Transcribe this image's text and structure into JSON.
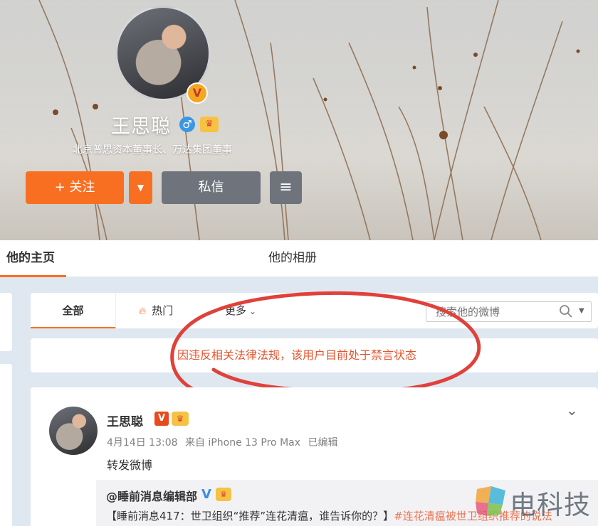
{
  "profile": {
    "name": "王思聪",
    "description": "北京普思资本董事长、万达集团董事",
    "verified_badge": "V",
    "gender_icon": "male-icon",
    "gender_symbol": "♂",
    "crown_symbol": "♛"
  },
  "actions": {
    "follow_label": "+ 关注",
    "follow_more": "▼",
    "message_label": "私信",
    "menu_symbol": "≡"
  },
  "tabs": [
    {
      "label": "他的主页",
      "active": true
    },
    {
      "label": "他的相册",
      "active": false
    }
  ],
  "filter": {
    "all_label": "全部",
    "hot_label": "热门",
    "hot_icon": "fire-icon",
    "more_label": "更多",
    "search_placeholder": "搜索他的微博"
  },
  "notice": {
    "text": "因违反相关法律法规，该用户目前处于禁言状态"
  },
  "post": {
    "author": "王思聪",
    "verified_badge": "V",
    "date": "4月14日 13:08",
    "source": "来自 iPhone 13 Pro Max",
    "edited": "已编辑",
    "body": "转发微博",
    "repost": {
      "author": "@睡前消息编辑部",
      "verified_badge": "V",
      "text": "【睡前消息417：世卫组织“推荐”连花清瘟，谁告诉你的？】",
      "hashtag": "#连花清瘟被世卫组织推荐的说法"
    }
  },
  "watermark": {
    "text": "电科技"
  },
  "colors": {
    "accent_orange": "#f86f22",
    "notice_red": "#e5552f",
    "circle_red": "#e0413a",
    "button_gray": "#6f737c"
  }
}
